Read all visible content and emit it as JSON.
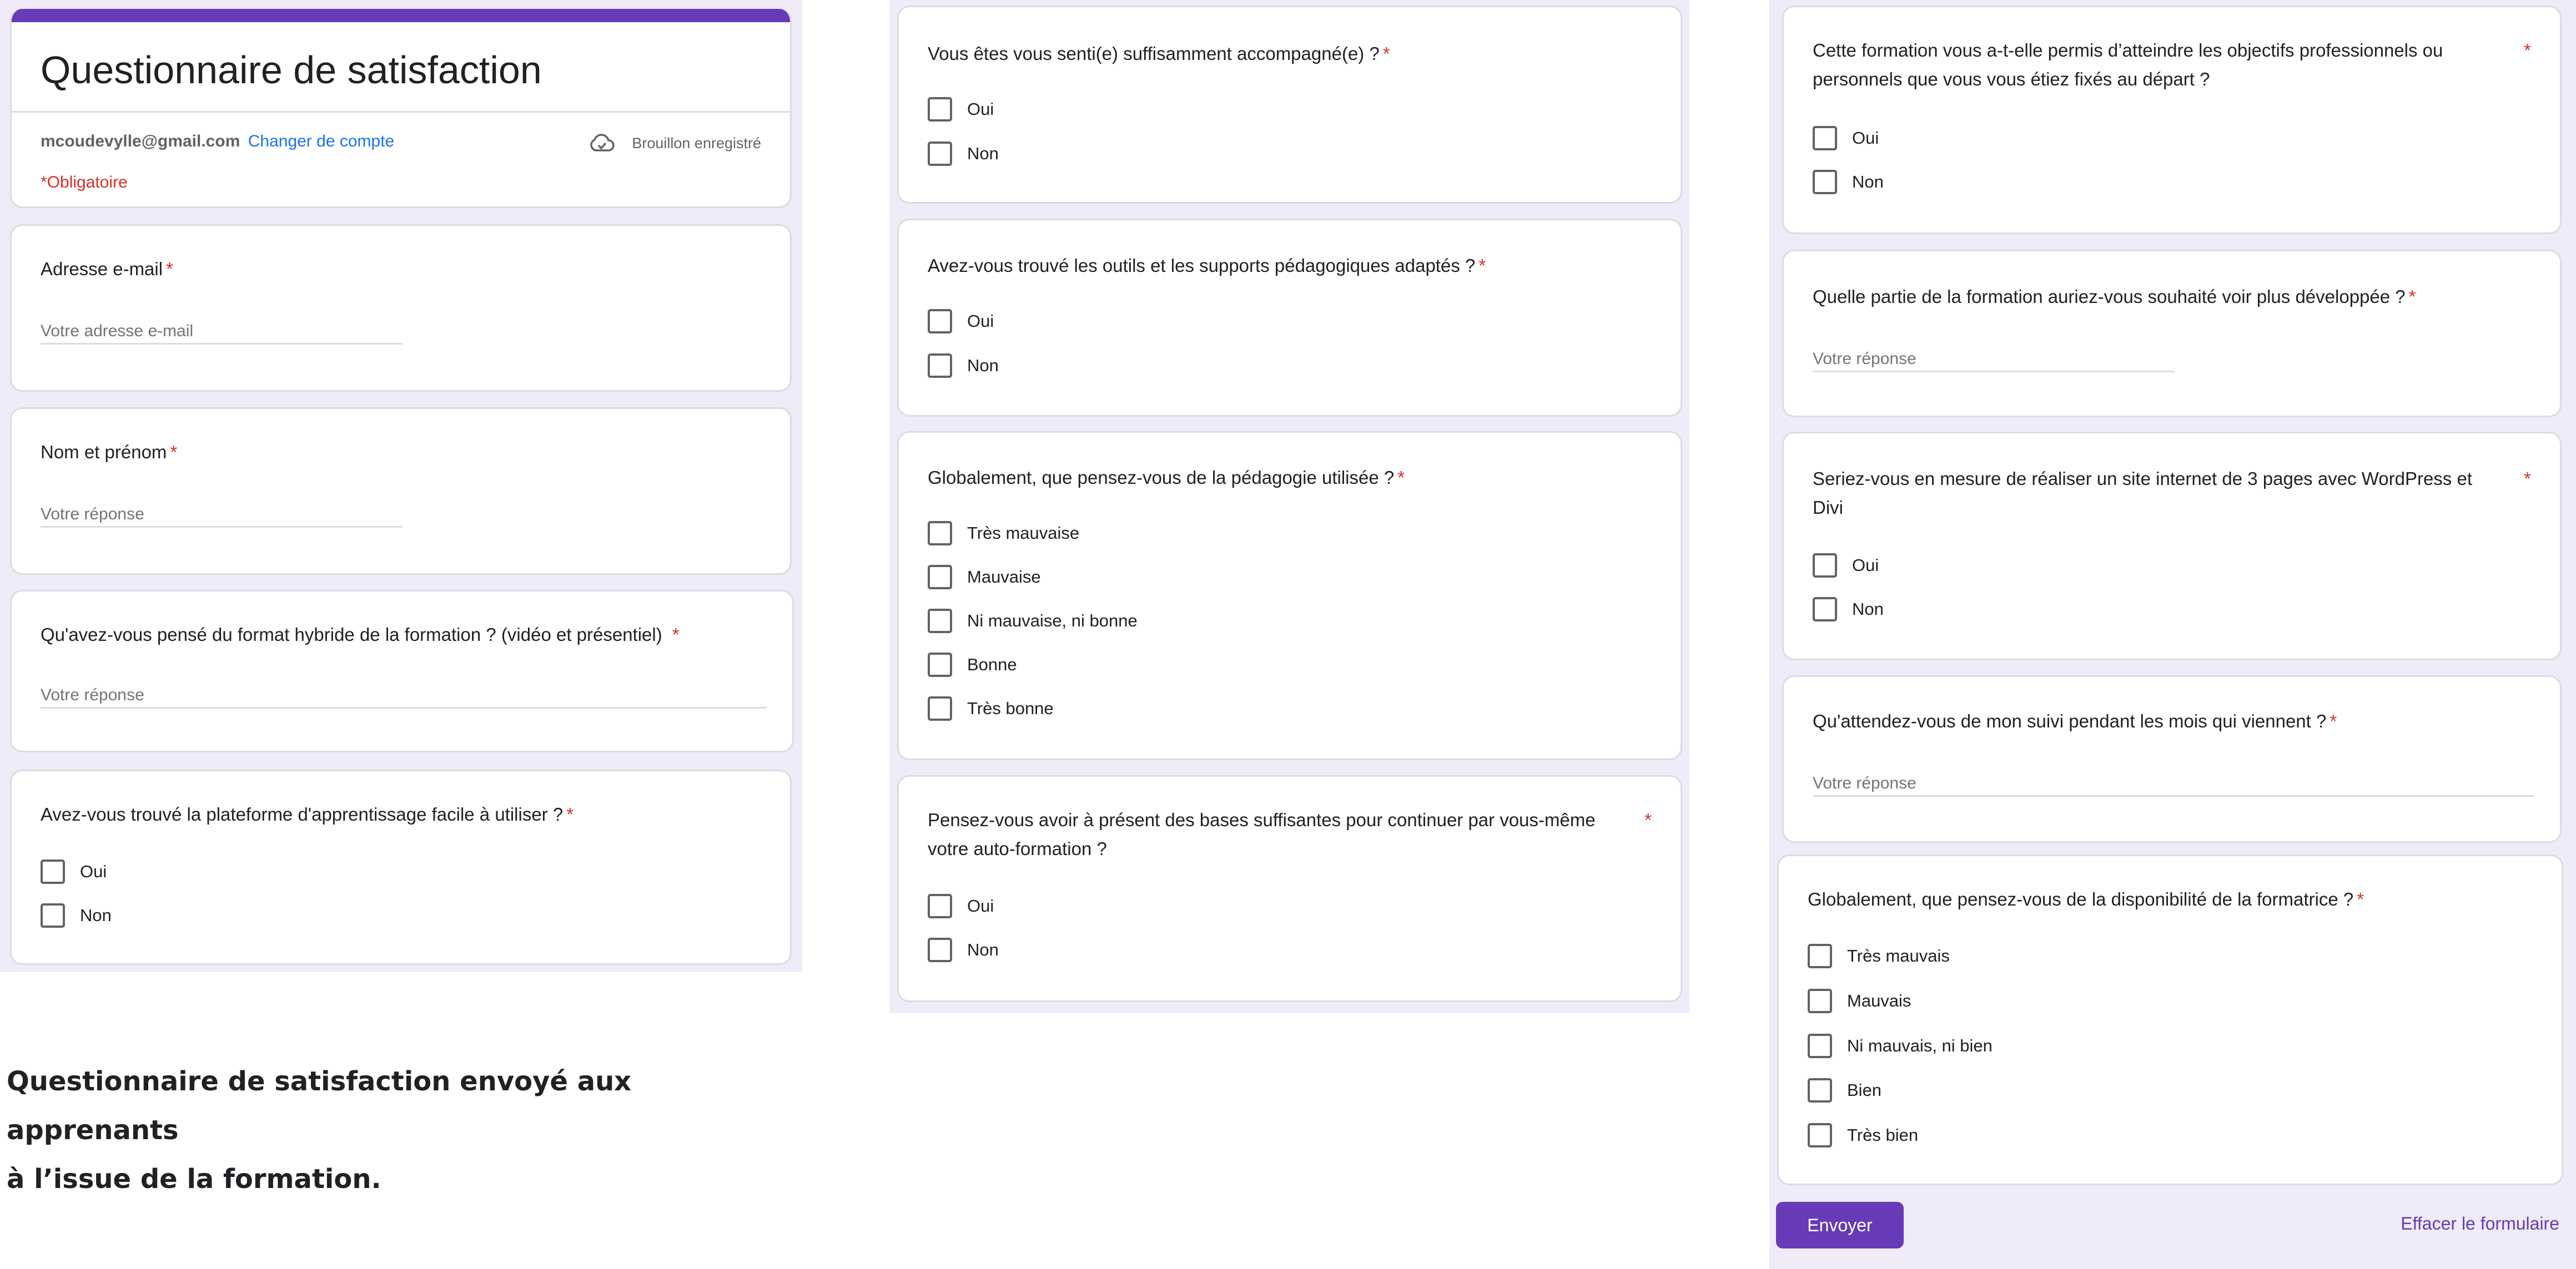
{
  "form": {
    "title": "Questionnaire de satisfaction",
    "account_email": "mcoudevylle@gmail.com",
    "change_account_label": "Changer de compte",
    "draft_status": "Brouillon enregistré",
    "required_note": "*Obligatoire"
  },
  "questions": {
    "email": {
      "label": "Adresse e-mail",
      "required": "*",
      "placeholder": "Votre adresse e-mail"
    },
    "name": {
      "label": "Nom et prénom",
      "required": "*",
      "placeholder": "Votre réponse"
    },
    "hybrid": {
      "label": "Qu'avez-vous pensé du format hybride de la formation ? (vidéo et présentiel)",
      "required": "*",
      "placeholder": "Votre réponse"
    },
    "platform": {
      "label": "Avez-vous trouvé la plateforme d'apprentissage facile à utiliser ?",
      "required": "*",
      "options": [
        "Oui",
        "Non"
      ]
    },
    "support": {
      "label": "Vous êtes vous senti(e) suffisamment accompagné(e) ?",
      "required": "*",
      "options": [
        "Oui",
        "Non"
      ]
    },
    "tools": {
      "label": "Avez-vous trouvé les outils et les supports pédagogiques adaptés ?",
      "required": "*",
      "options": [
        "Oui",
        "Non"
      ]
    },
    "pedagogy": {
      "label": "Globalement, que pensez-vous de la pédagogie utilisée ?",
      "required": "*",
      "options": [
        "Très mauvaise",
        "Mauvaise",
        "Ni mauvaise, ni bonne",
        "Bonne",
        "Très bonne"
      ]
    },
    "basics": {
      "label": "Pensez-vous avoir à présent des bases suffisantes pour continuer par vous-même votre auto-formation ?",
      "required": "*",
      "options": [
        "Oui",
        "Non"
      ]
    },
    "objectives": {
      "label": "Cette formation vous a-t-elle permis d’atteindre les objectifs professionnels ou personnels que vous vous étiez fixés au départ ?",
      "required": "*",
      "options": [
        "Oui",
        "Non"
      ]
    },
    "developed": {
      "label": "Quelle partie de la formation auriez-vous souhaité voir plus développée ?",
      "required": "*",
      "placeholder": "Votre réponse"
    },
    "wordpress": {
      "label": "Seriez-vous en mesure de réaliser un site internet de 3 pages avec WordPress et Divi",
      "required": "*",
      "options": [
        "Oui",
        "Non"
      ]
    },
    "followup": {
      "label": "Qu'attendez-vous de mon suivi pendant les mois qui viennent ?",
      "required": "*",
      "placeholder": "Votre réponse"
    },
    "availability": {
      "label": "Globalement, que pensez-vous de la disponibilité de la formatrice ?",
      "required": "*",
      "options": [
        "Très mauvais",
        "Mauvais",
        "Ni mauvais, ni bien",
        "Bien",
        "Très bien"
      ]
    }
  },
  "actions": {
    "submit_label": "Envoyer",
    "clear_label": "Effacer le formulaire"
  },
  "caption": {
    "line1": "Questionnaire de satisfaction envoyé aux apprenants",
    "line2": "à l’issue de la formation."
  },
  "colors": {
    "accent": "#673ab7",
    "page_background": "#f0ebf8",
    "required": "#d93025",
    "link": "#1a73e8",
    "border": "#dadce0"
  }
}
